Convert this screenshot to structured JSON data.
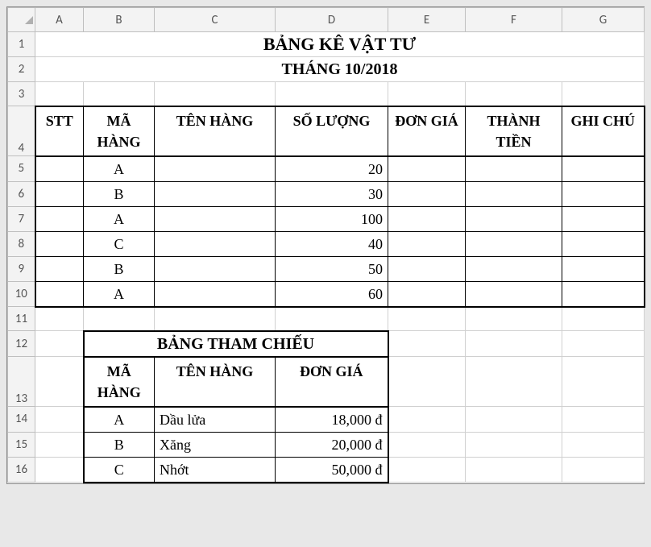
{
  "columns": [
    "A",
    "B",
    "C",
    "D",
    "E",
    "F",
    "G"
  ],
  "rows": [
    "1",
    "2",
    "3",
    "4",
    "5",
    "6",
    "7",
    "8",
    "9",
    "10",
    "11",
    "12",
    "13",
    "14",
    "15",
    "16"
  ],
  "title": "BẢNG KÊ VẬT TƯ",
  "subtitle": "THÁNG 10/2018",
  "main_headers": {
    "stt": "STT",
    "ma_hang": "MÃ HÀNG",
    "ten_hang": "TÊN HÀNG",
    "so_luong": "SỐ LƯỢNG",
    "don_gia": "ĐƠN GIÁ",
    "thanh_tien": "THÀNH TIỀN",
    "ghi_chu": "GHI CHÚ"
  },
  "main_rows": [
    {
      "ma_hang": "A",
      "so_luong": "20"
    },
    {
      "ma_hang": "B",
      "so_luong": "30"
    },
    {
      "ma_hang": "A",
      "so_luong": "100"
    },
    {
      "ma_hang": "C",
      "so_luong": "40"
    },
    {
      "ma_hang": "B",
      "so_luong": "50"
    },
    {
      "ma_hang": "A",
      "so_luong": "60"
    }
  ],
  "ref_title": "BẢNG THAM CHIẾU",
  "ref_headers": {
    "ma_hang": "MÃ HÀNG",
    "ten_hang": "TÊN HÀNG",
    "don_gia": "ĐƠN GIÁ"
  },
  "ref_rows": [
    {
      "ma_hang": "A",
      "ten_hang": "Dầu lửa",
      "don_gia": "18,000 đ"
    },
    {
      "ma_hang": "B",
      "ten_hang": "Xăng",
      "don_gia": "20,000 đ"
    },
    {
      "ma_hang": "C",
      "ten_hang": "Nhớt",
      "don_gia": "50,000 đ"
    }
  ]
}
